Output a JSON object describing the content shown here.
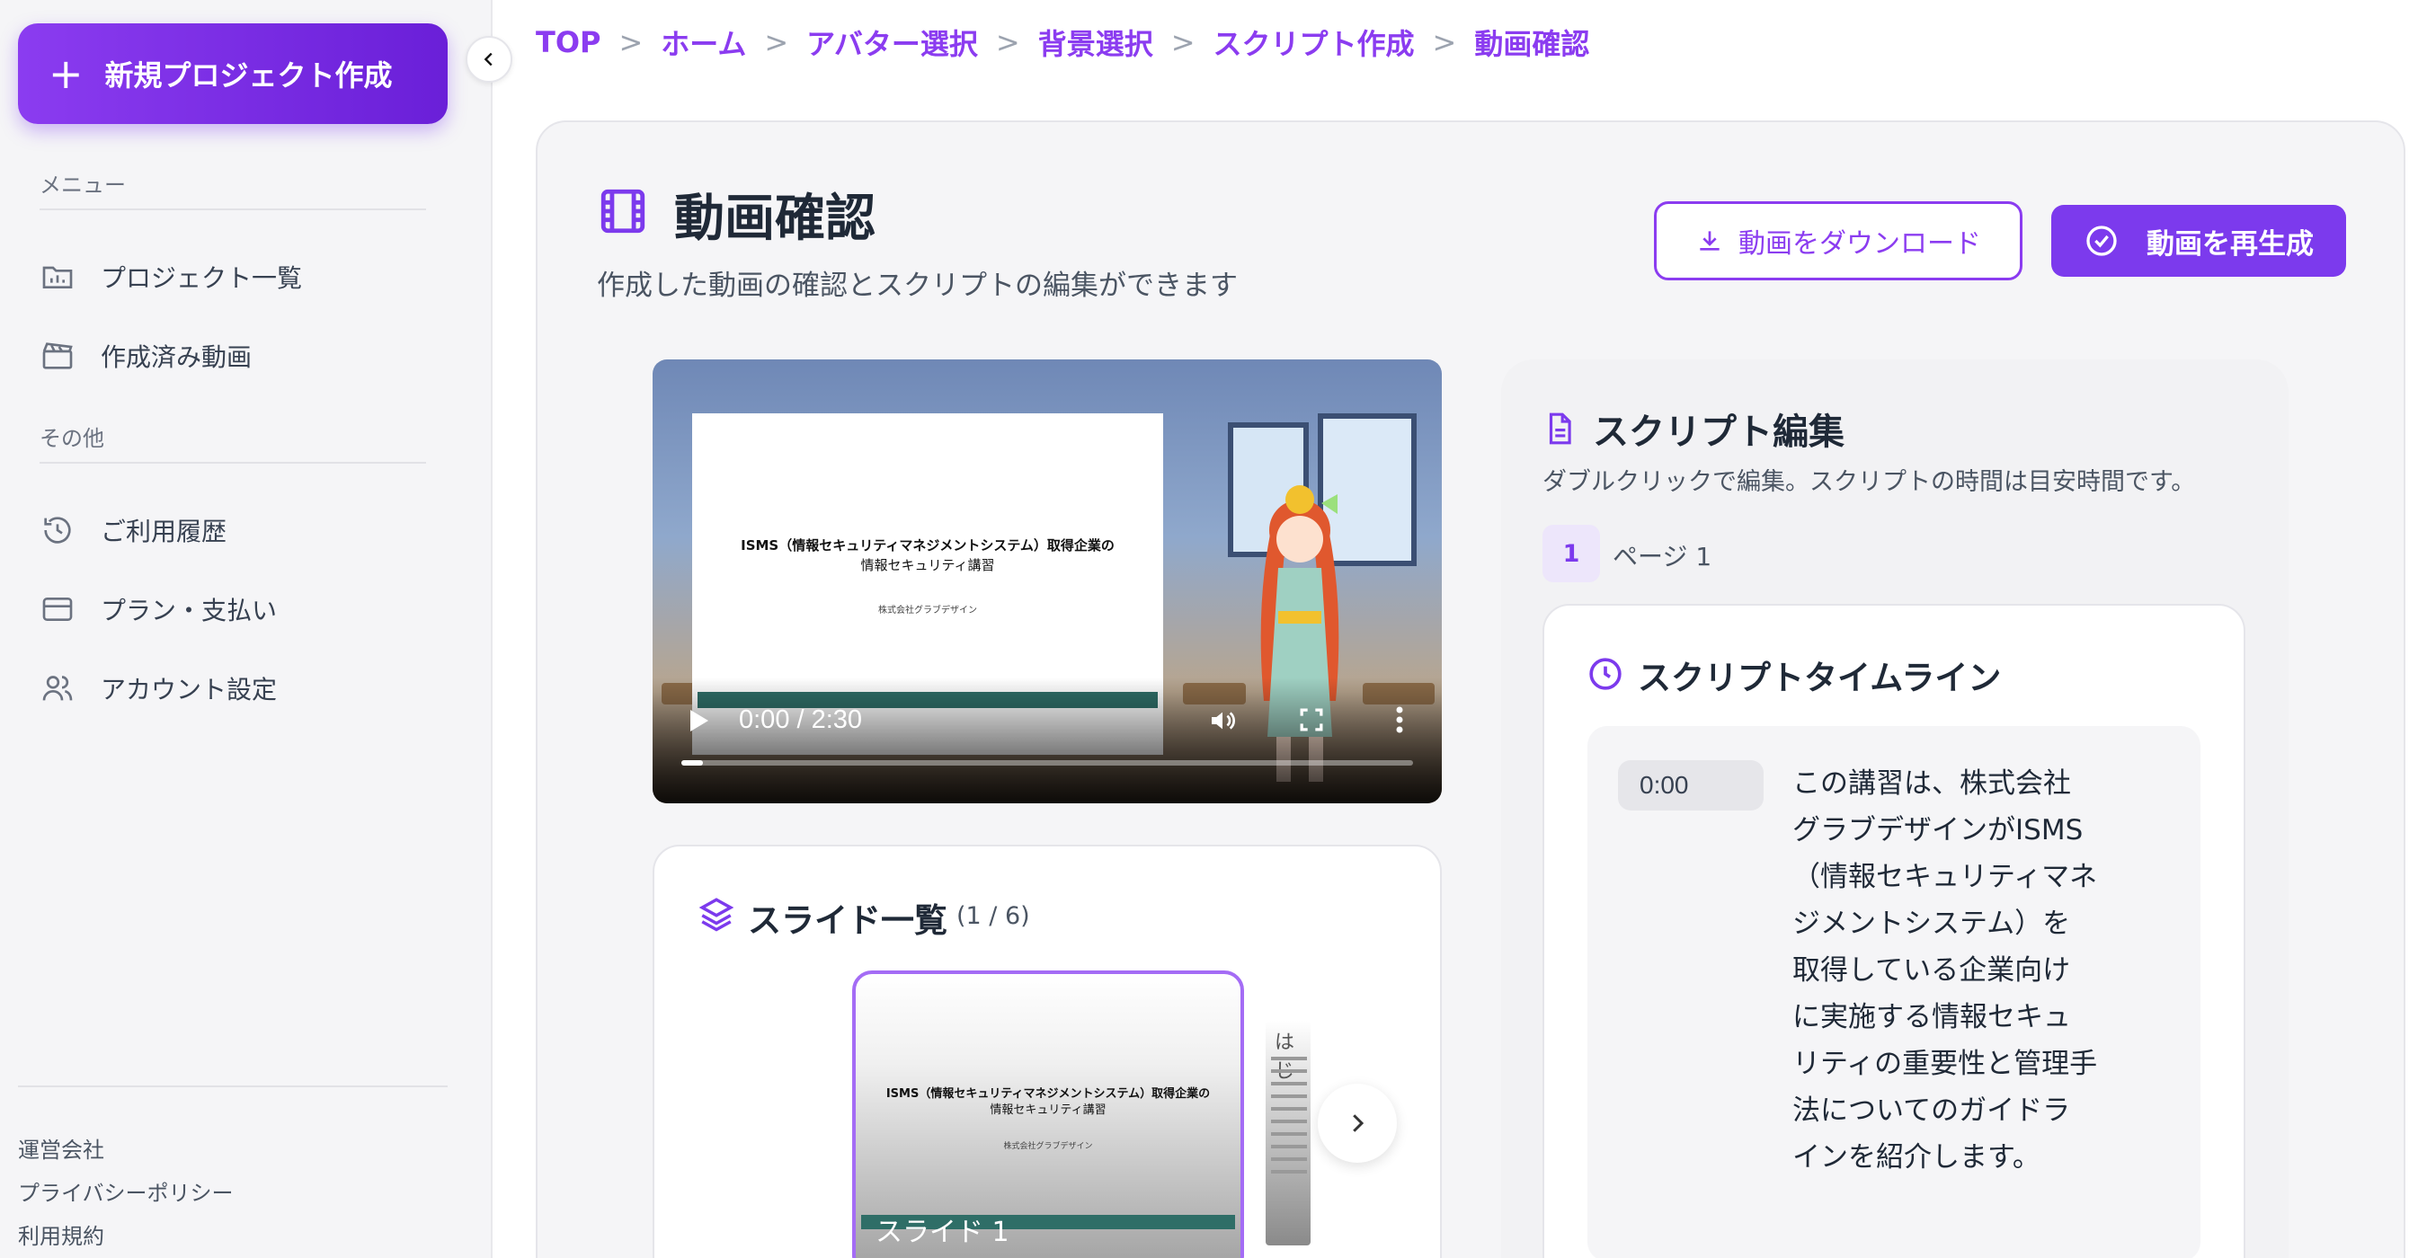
{
  "sidebar": {
    "new_project_label": "新規プロジェクト作成",
    "menu_section": "メニュー",
    "menu_items": [
      {
        "label": "プロジェクト一覧",
        "icon": "folder-chart-icon"
      },
      {
        "label": "作成済み動画",
        "icon": "clapperboard-icon"
      }
    ],
    "other_section": "その他",
    "other_items": [
      {
        "label": "ご利用履歴",
        "icon": "history-icon"
      },
      {
        "label": "プラン・支払い",
        "icon": "credit-card-icon"
      },
      {
        "label": "アカウント設定",
        "icon": "users-icon"
      }
    ],
    "footer_links": [
      "運営会社",
      "プライバシーポリシー",
      "利用規約"
    ]
  },
  "breadcrumb": [
    "TOP",
    "ホーム",
    "アバター選択",
    "背景選択",
    "スクリプト作成",
    "動画確認"
  ],
  "breadcrumb_separator": ">",
  "header": {
    "title": "動画確認",
    "subtitle": "作成した動画の確認とスクリプトの編集ができます",
    "download_label": "動画をダウンロード",
    "regenerate_label": "動画を再生成"
  },
  "video": {
    "time_display": "0:00 / 2:30",
    "progress_fraction": 0.03,
    "slide_title_line1": "ISMS（情報セキュリティマネジメントシステム）取得企業の",
    "slide_title_line2": "情報セキュリティ講習",
    "slide_company": "株式会社グラブデザイン"
  },
  "slides": {
    "title": "スライド一覧",
    "count": "(1 / 6)",
    "current_label": "スライド 1",
    "thumb_title_line1": "ISMS（情報セキュリティマネジメントシステム）取得企業の",
    "thumb_title_line2": "情報セキュリティ講習",
    "thumb_company": "株式会社グラブデザイン",
    "next_thumb_heading": "はじ"
  },
  "script": {
    "title": "スクリプト編集",
    "subtitle": "ダブルクリックで編集。スクリプトの時間は目安時間です。",
    "page_number": "1",
    "page_label": "ページ 1",
    "timeline_title": "スクリプトタイムライン",
    "entries": [
      {
        "time": "0:00",
        "text": "この講習は、株式会社グラブデザインがISMS（情報セキュリティマネジメントシステム）を取得している企業向けに実施する情報セキュリティの重要性と管理手法についてのガイドラインを紹介します。"
      }
    ]
  },
  "colors": {
    "accent": "#7c3aed",
    "accent_light": "#8b3cf0",
    "sidebar_bg": "#f5f5f7"
  }
}
